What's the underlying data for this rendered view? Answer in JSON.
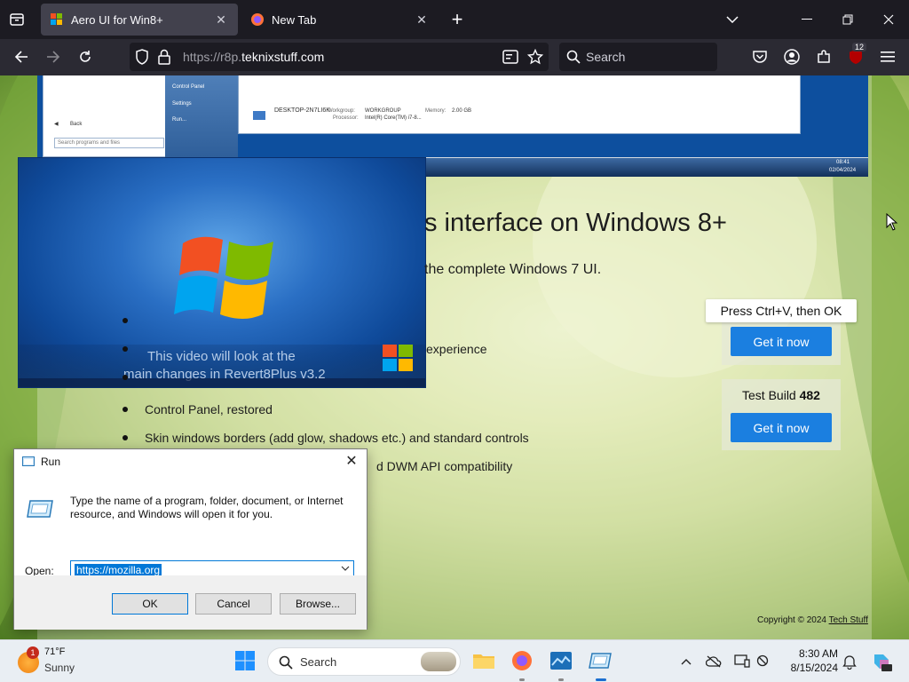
{
  "browser": {
    "tabs": [
      {
        "title": "Aero UI for Win8+",
        "active": true
      },
      {
        "title": "New Tab",
        "active": false
      }
    ],
    "new_tab_label": "+",
    "url_prefix": "https://r8p.",
    "url_domain": "teknixstuff.com",
    "search_placeholder": "Search",
    "extension_badge": "12"
  },
  "page": {
    "headline": "s interface on Windows 8+",
    "subline": "the complete Windows 7 UI.",
    "bullets": [
      "",
      "experience",
      "",
      "Control Panel, restored",
      "Skin windows borders (add glow, shadows etc.) and standard controls",
      "d DWM API compatibility"
    ],
    "video": {
      "line1": "This video will look at the",
      "line2": "main changes in Revert8Plus v3.2"
    },
    "tooltip": "Press Ctrl+V, then OK",
    "get_it_now_1": "Get it now",
    "build_label": "Test Build",
    "build_number": "482",
    "get_it_now_2": "Get it now",
    "copyright_text": "Copyright © 2024",
    "copyright_link": "Tech Stuff",
    "inner_screenshot": {
      "start_items": [
        "Control Panel",
        "Settings",
        "Run..."
      ],
      "back": "Back",
      "search_placeholder": "Search programs and files",
      "computer_name": "DESKTOP-2N7LI6K",
      "workgroup_label": "Workgroup:",
      "workgroup": "WORKGROUP",
      "memory_label": "Memory:",
      "memory": "2.00 GB",
      "processor_label": "Processor:",
      "processor": "Intel(R) Core(TM) i7-8...",
      "clock_time": "08:41",
      "clock_date": "02/04/2024"
    }
  },
  "run_dialog": {
    "title": "Run",
    "description": "Type the name of a program, folder, document, or Internet resource, and Windows will open it for you.",
    "open_label": "Open:",
    "open_value": "https://mozilla.org",
    "ok": "OK",
    "cancel": "Cancel",
    "browse": "Browse..."
  },
  "taskbar": {
    "weather_temp": "71°F",
    "weather_cond": "Sunny",
    "weather_badge": "1",
    "search_placeholder": "Search",
    "time": "8:30 AM",
    "date": "8/15/2024"
  },
  "colors": {
    "accent": "#1b7fe0",
    "browser_dark": "#1c1b22",
    "toolbar": "#2b2a33"
  }
}
